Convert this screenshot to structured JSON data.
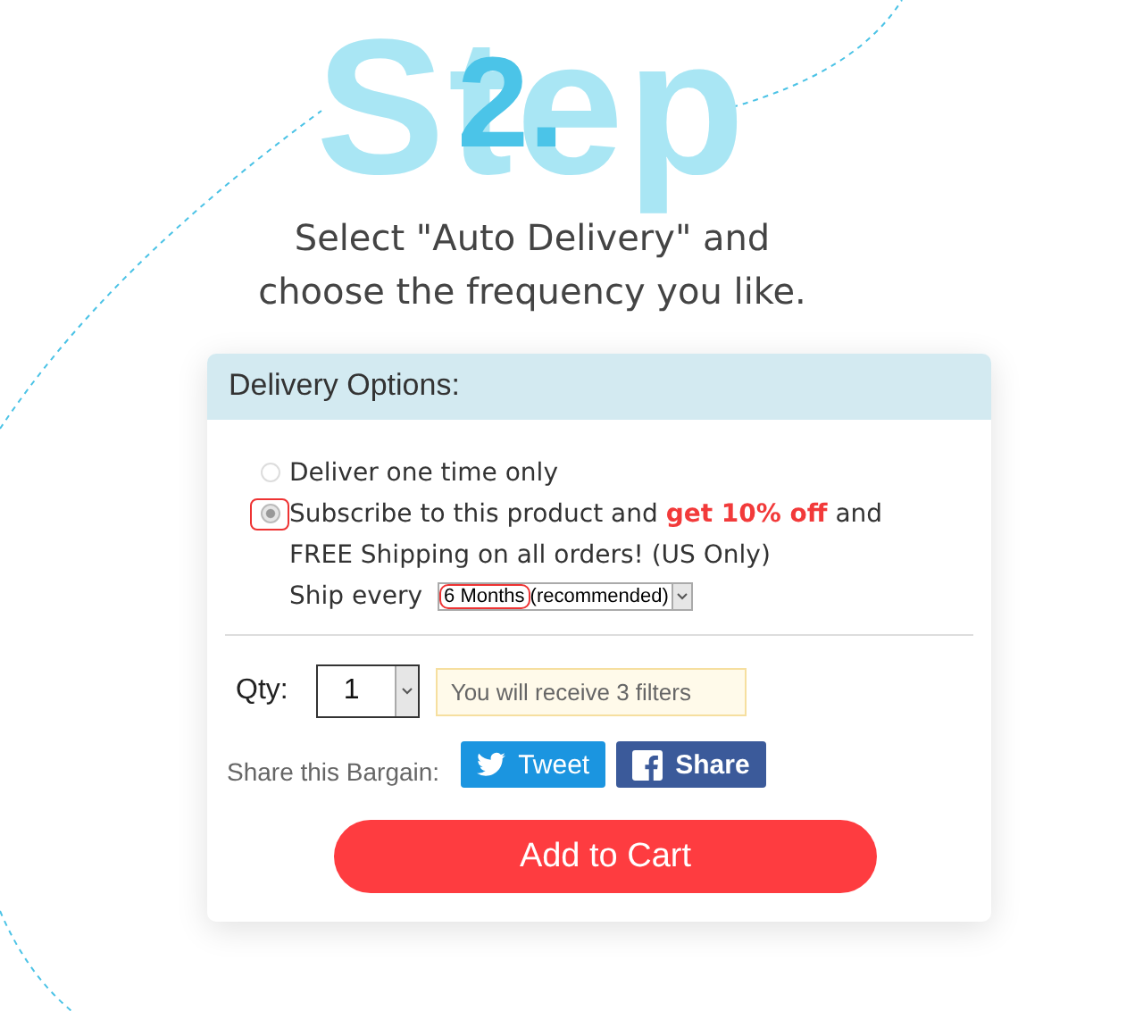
{
  "hero": {
    "backdrop_word": "Step",
    "number": "2.",
    "instruction_lines": [
      "Select \"Auto Delivery\" and",
      "choose the frequency you like."
    ]
  },
  "card": {
    "title": "Delivery Options:",
    "options": [
      {
        "label": "Deliver one time only",
        "selected": false,
        "highlighted": false
      },
      {
        "label": "Subscribe to this product and **get 10% off** and",
        "selected": true,
        "highlighted": true
      }
    ],
    "note": "FREE Shipping on all orders! (US Only)",
    "frequency": {
      "label": "Ship every",
      "value": "6 Months",
      "suffix": "(recommended)",
      "highlighted": true
    },
    "qty": {
      "label": "Qty:",
      "value": "1",
      "hint": "You will receive 3 filters"
    },
    "share": {
      "label": "Share this Bargain:",
      "buttons": [
        {
          "kind": "twitter",
          "label": "Tweet"
        },
        {
          "kind": "facebook",
          "label": "Share"
        }
      ]
    },
    "cta": "Add to Cart"
  }
}
